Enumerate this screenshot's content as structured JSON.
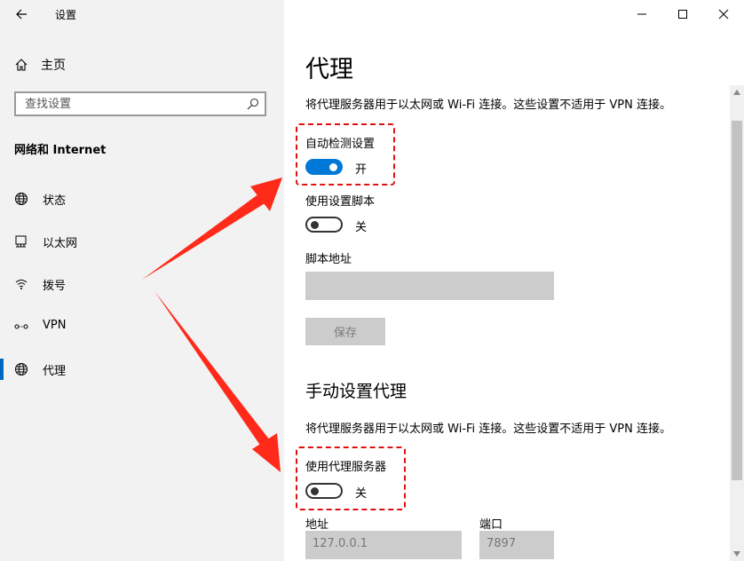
{
  "window": {
    "title": "设置"
  },
  "sidebar": {
    "home_label": "主页",
    "search_placeholder": "查找设置",
    "section_title": "网络和 Internet",
    "items": [
      {
        "label": "状态",
        "icon": "globe-status-icon"
      },
      {
        "label": "以太网",
        "icon": "ethernet-icon"
      },
      {
        "label": "拨号",
        "icon": "dialup-icon"
      },
      {
        "label": "VPN",
        "icon": "vpn-icon"
      },
      {
        "label": "代理",
        "icon": "globe-icon",
        "selected": true
      }
    ]
  },
  "main": {
    "title": "代理",
    "auto_description": "将代理服务器用于以太网或 Wi-Fi 连接。这些设置不适用于 VPN 连接。",
    "auto_detect": {
      "label": "自动检测设置",
      "state": "开",
      "on": true
    },
    "use_script": {
      "label": "使用设置脚本",
      "state": "关",
      "on": false
    },
    "script_address": {
      "label": "脚本地址",
      "value": ""
    },
    "save_label": "保存",
    "manual_title": "手动设置代理",
    "manual_description": "将代理服务器用于以太网或 Wi-Fi 连接。这些设置不适用于 VPN 连接。",
    "use_proxy": {
      "label": "使用代理服务器",
      "state": "关",
      "on": false
    },
    "address": {
      "label": "地址",
      "value": "127.0.0.1"
    },
    "port": {
      "label": "端口",
      "value": "7897"
    }
  },
  "colors": {
    "accent": "#0078d7",
    "annotation": "#e01010",
    "disabled_field": "#cccccc",
    "sidebar_bg": "#f2f2f2"
  }
}
